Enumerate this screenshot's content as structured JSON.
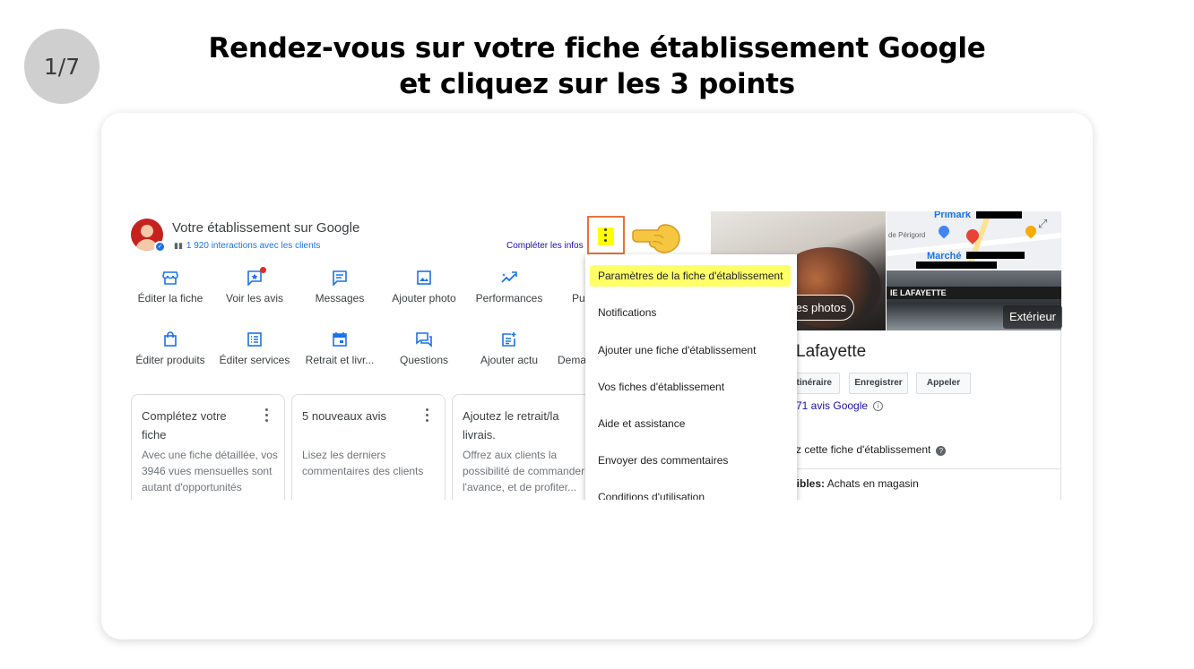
{
  "step": "1/7",
  "title_line1": "Rendez-vous sur votre fiche établissement Google",
  "title_line2": "et cliquez sur les 3 points",
  "header": {
    "title": "Votre établissement sur Google",
    "interactions": "1 920 interactions avec les clients",
    "complete_link": "Compléter les infos"
  },
  "actions_row1": [
    "Éditer la fiche",
    "Voir les avis",
    "Messages",
    "Ajouter photo",
    "Performances",
    "Pu"
  ],
  "actions_row2": [
    "Éditer produits",
    "Éditer services",
    "Retrait et livr...",
    "Questions",
    "Ajouter actu",
    "Dema"
  ],
  "cards": [
    {
      "title": "Complétez votre fiche",
      "desc": "Avec une fiche détaillée, vos 3946 vues mensuelles sont autant d'opportunités"
    },
    {
      "title": "5 nouveaux avis",
      "desc": "Lisez les derniers commentaires des clients"
    },
    {
      "title": "Ajoutez le retrait/la livrais.",
      "desc": "Offrez aux clients la possibilité de commander à l'avance, et de profiter..."
    }
  ],
  "menu": {
    "items": [
      "Paramètres de la fiche d'établissement",
      "Notifications",
      "Ajouter une fiche d'établissement",
      "Vos fiches d'établissement",
      "Aide et assistance",
      "Envoyer des commentaires",
      "Conditions d'utilisation"
    ]
  },
  "panel": {
    "photos_btn": "des photos",
    "exterior": "Extérieur",
    "map_primark": "Primark",
    "map_marche": "Marché",
    "map_small": "de Périgord",
    "store_sign": "IE  LAFAYETTE",
    "store_name": "Lafayette",
    "btn_itinerary": "Itinéraire",
    "btn_save": "Enregistrer",
    "btn_call": "Appeler",
    "reviews": "71 avis Google",
    "manage": "z cette fiche d'établissement",
    "services_label": "onibles:",
    "services_value": "Achats en magasin"
  }
}
